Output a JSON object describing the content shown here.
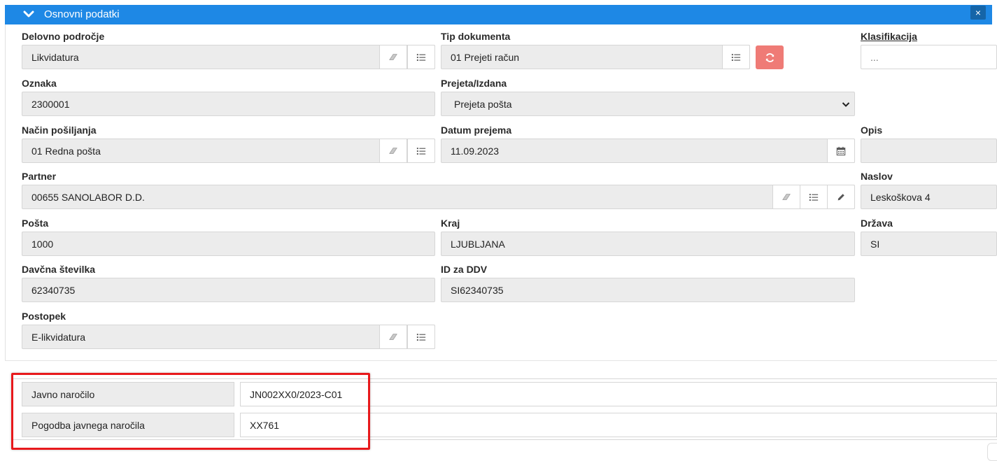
{
  "header": {
    "title": "Osnovni podatki",
    "close_symbol": "×"
  },
  "fields": {
    "delovno_podrocje": {
      "label": "Delovno področje",
      "value": "Likvidatura"
    },
    "tip_dokumenta": {
      "label": "Tip dokumenta",
      "value": "01 Prejeti račun"
    },
    "klasifikacija": {
      "label": "Klasifikacija",
      "value": "..."
    },
    "oznaka": {
      "label": "Oznaka",
      "value": "2300001"
    },
    "prejeta_izdana": {
      "label": "Prejeta/Izdana",
      "value": "Prejeta pošta"
    },
    "nacin_posiljanja": {
      "label": "Način pošiljanja",
      "value": "01 Redna pošta"
    },
    "datum_prejema": {
      "label": "Datum prejema",
      "value": "11.09.2023"
    },
    "opis": {
      "label": "Opis",
      "value": ""
    },
    "partner": {
      "label": "Partner",
      "value": "00655 SANOLABOR D.D."
    },
    "naslov": {
      "label": "Naslov",
      "value": "Leskoškova 4"
    },
    "posta": {
      "label": "Pošta",
      "value": "1000"
    },
    "kraj": {
      "label": "Kraj",
      "value": "LJUBLJANA"
    },
    "drzava": {
      "label": "Država",
      "value": "SI"
    },
    "davcna_stevilka": {
      "label": "Davčna številka",
      "value": "62340735"
    },
    "id_za_ddv": {
      "label": "ID za DDV",
      "value": "SI62340735"
    },
    "postopek": {
      "label": "Postopek",
      "value": "E-likvidatura"
    }
  },
  "extra": {
    "javno_narocilo": {
      "label": "Javno naročilo",
      "value": "JN002XX0/2023-C01"
    },
    "pogodba": {
      "label": "Pogodba javnega naročila",
      "value": "XX761"
    }
  },
  "colors": {
    "header": "#1e88e5",
    "refresh_button": "#ef7b76",
    "highlight_box": "#e8191c"
  },
  "icons": [
    "chevron-down-icon",
    "close-icon",
    "eraser-icon",
    "list-icon",
    "refresh-icon",
    "calendar-icon",
    "pencil-icon"
  ]
}
